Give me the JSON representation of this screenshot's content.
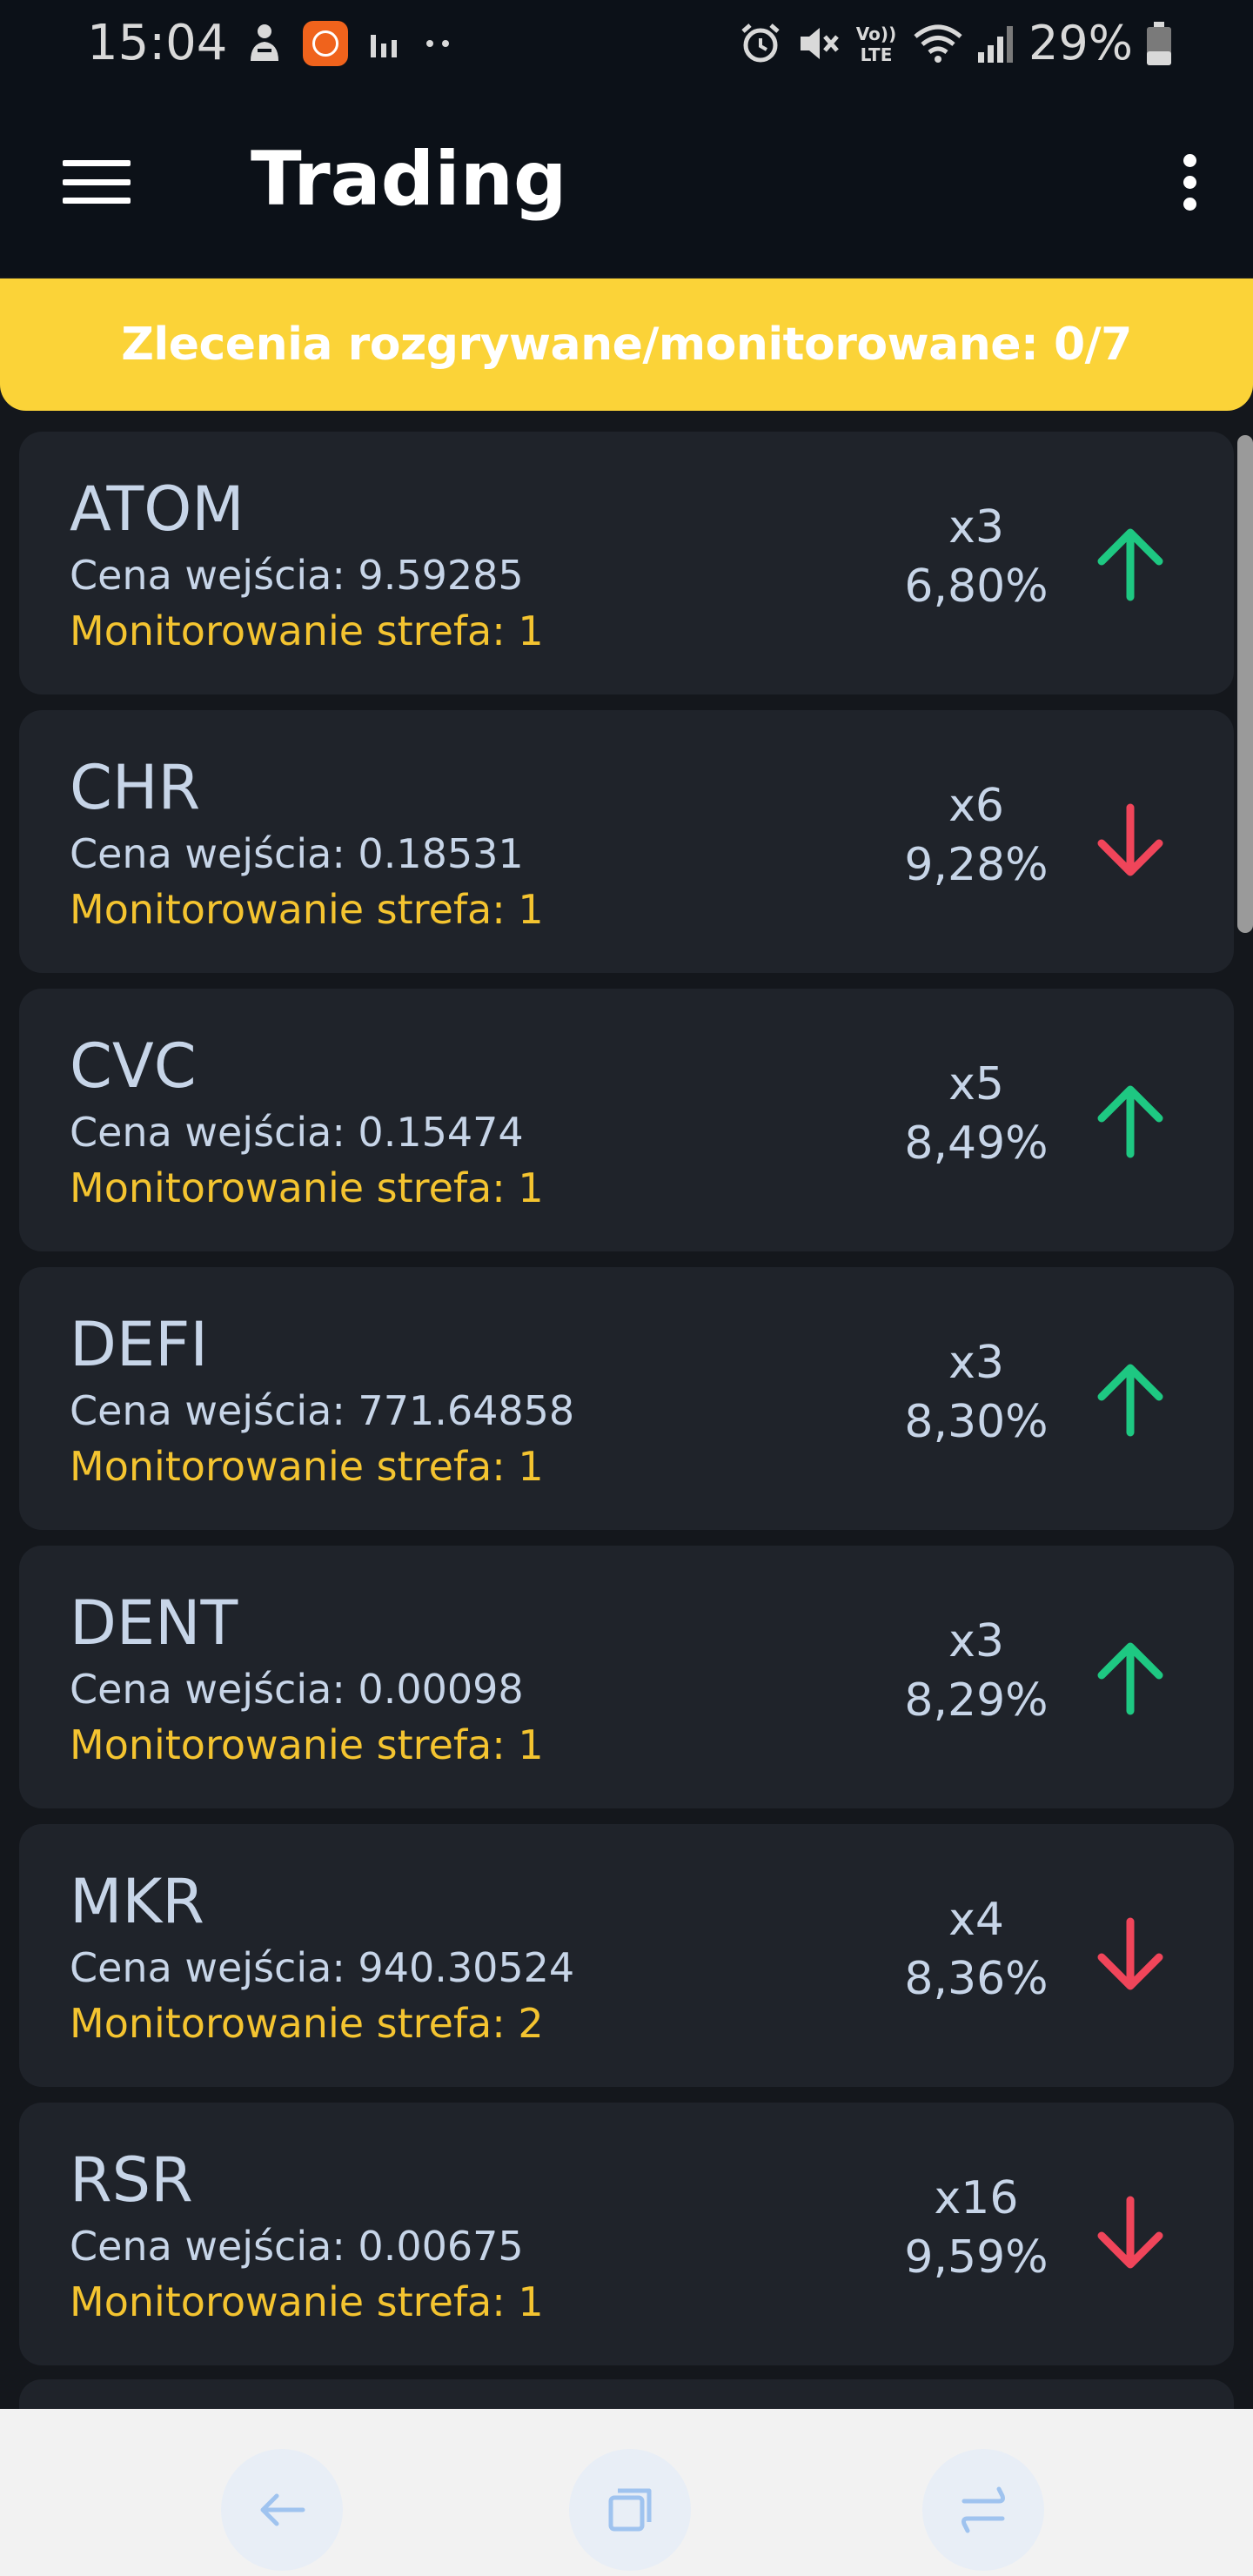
{
  "status_bar": {
    "time": "15:04",
    "battery_text": "29%",
    "icons": [
      "notification-icon",
      "mi-app-icon",
      "signal-bars-icon",
      "more-dots-icon",
      "alarm-icon",
      "mute-icon",
      "volte-icon",
      "wifi-icon",
      "cell-signal-icon",
      "battery-icon"
    ]
  },
  "app_bar": {
    "title": "Trading",
    "menu_icon": "hamburger-menu-icon",
    "overflow_icon": "more-vert-icon"
  },
  "banner": {
    "text": "Zlecenia rozgrywane/monitorowane: 0/7",
    "background": "#fbd338"
  },
  "colors": {
    "up": "#1ec882",
    "down": "#f0455a",
    "zone": "#f4c430",
    "card": "#1f232a"
  },
  "positions": [
    {
      "symbol": "ATOM",
      "price": "Cena wejścia: 9.59285",
      "zone": "Monitorowanie strefa: 1",
      "leverage": "x3",
      "percent": "6,80%",
      "direction": "up"
    },
    {
      "symbol": "CHR",
      "price": "Cena wejścia: 0.18531",
      "zone": "Monitorowanie strefa: 1",
      "leverage": "x6",
      "percent": "9,28%",
      "direction": "down"
    },
    {
      "symbol": "CVC",
      "price": "Cena wejścia: 0.15474",
      "zone": "Monitorowanie strefa: 1",
      "leverage": "x5",
      "percent": "8,49%",
      "direction": "up"
    },
    {
      "symbol": "DEFI",
      "price": "Cena wejścia: 771.64858",
      "zone": "Monitorowanie strefa: 1",
      "leverage": "x3",
      "percent": "8,30%",
      "direction": "up"
    },
    {
      "symbol": "DENT",
      "price": "Cena wejścia: 0.00098",
      "zone": "Monitorowanie strefa: 1",
      "leverage": "x3",
      "percent": "8,29%",
      "direction": "up"
    },
    {
      "symbol": "MKR",
      "price": "Cena wejścia: 940.30524",
      "zone": "Monitorowanie strefa: 2",
      "leverage": "x4",
      "percent": "8,36%",
      "direction": "down"
    },
    {
      "symbol": "RSR",
      "price": "Cena wejścia: 0.00675",
      "zone": "Monitorowanie strefa: 1",
      "leverage": "x16",
      "percent": "9,59%",
      "direction": "down"
    }
  ],
  "nav_bar": {
    "icons": [
      "back-icon",
      "recents-icon",
      "switch-icon"
    ]
  }
}
